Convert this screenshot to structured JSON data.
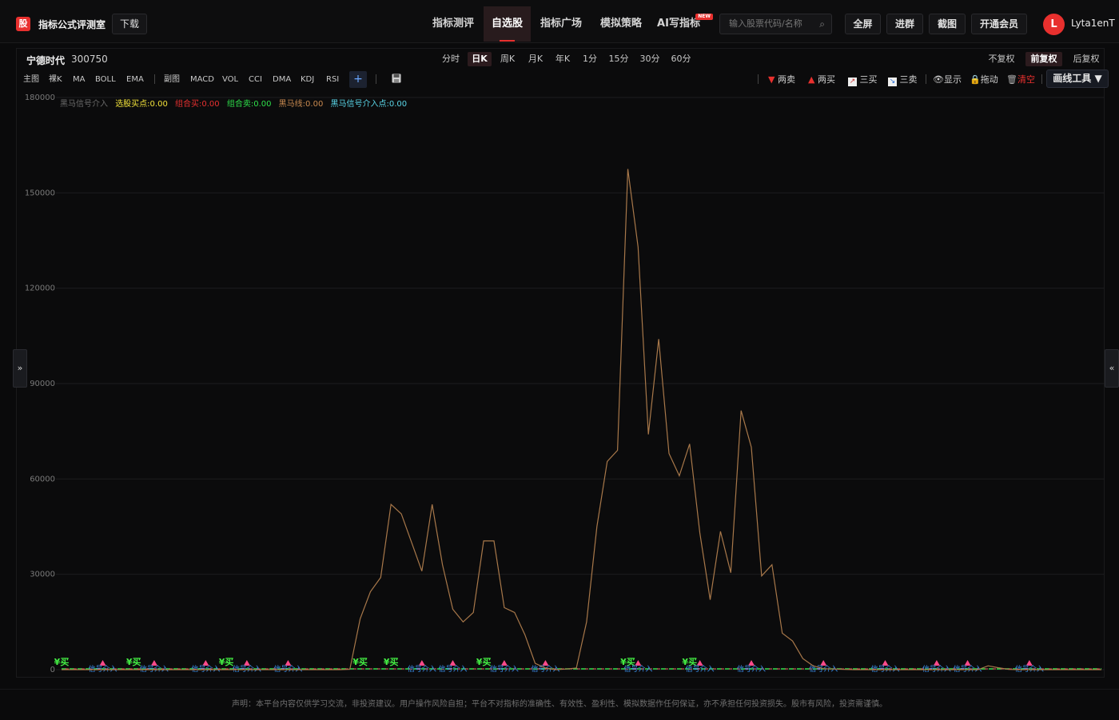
{
  "header": {
    "logo_char": "股",
    "site_title": "指标公式评测室",
    "download_label": "下载",
    "nav": [
      {
        "label": "指标测评",
        "active": false
      },
      {
        "label": "自选股",
        "active": true
      },
      {
        "label": "指标广场",
        "active": false
      },
      {
        "label": "模拟策略",
        "active": false
      },
      {
        "label": "AI写指标",
        "active": false,
        "badge": "NEW"
      }
    ],
    "search_placeholder": "输入股票代码/名称",
    "buttons": [
      "全屏",
      "进群",
      "截图",
      "开通会员"
    ],
    "avatar_letter": "L",
    "username": "Lyta1enT"
  },
  "stock": {
    "name": "宁德时代",
    "code": "300750"
  },
  "periods": [
    {
      "label": "分时",
      "active": false
    },
    {
      "label": "日K",
      "active": true
    },
    {
      "label": "周K",
      "active": false
    },
    {
      "label": "月K",
      "active": false
    },
    {
      "label": "年K",
      "active": false
    },
    {
      "label": "1分",
      "active": false
    },
    {
      "label": "15分",
      "active": false
    },
    {
      "label": "30分",
      "active": false
    },
    {
      "label": "60分",
      "active": false
    }
  ],
  "adjust": [
    {
      "label": "不复权",
      "active": false
    },
    {
      "label": "前复权",
      "active": true
    },
    {
      "label": "后复权",
      "active": false
    }
  ],
  "indicators_main": [
    "主图",
    "裸K",
    "MA",
    "BOLL",
    "EMA"
  ],
  "indicators_sub": [
    "副图",
    "MACD",
    "VOL",
    "CCI",
    "DMA",
    "KDJ",
    "RSI"
  ],
  "plus_label": "+",
  "tools": [
    {
      "icon": "triangle-down-icon",
      "label": "两卖"
    },
    {
      "icon": "triangle-up-icon",
      "label": "两买"
    },
    {
      "icon": "line-up-icon",
      "label": "三买"
    },
    {
      "icon": "line-down-icon",
      "label": "三卖"
    },
    {
      "icon": "eye-icon",
      "label": "显示"
    },
    {
      "icon": "lock-icon",
      "label": "拖动"
    },
    {
      "icon": "trash-icon",
      "label": "清空"
    }
  ],
  "draw_tool_label": "画线工具 ▼",
  "side_left": "»",
  "side_right": "«",
  "legend": [
    {
      "label": "黑马信号介入",
      "color": "#6b6b6b"
    },
    {
      "label": "选股买点:0.00",
      "color": "#f2e23a"
    },
    {
      "label": "组合买:0.00",
      "color": "#e83030"
    },
    {
      "label": "组合卖:0.00",
      "color": "#2ee04a"
    },
    {
      "label": "黑马线:0.00",
      "color": "#c98a50"
    },
    {
      "label": "黑马信号介入点:0.00",
      "color": "#5ad6e8"
    }
  ],
  "footer": "声明：本平台内容仅供学习交流，非投资建议。用户操作风险自担；平台不对指标的准确性、有效性、盈利性、模拟数据作任何保证，亦不承担任何投资损失。股市有风险，投资需谨慎。",
  "chart_data": {
    "type": "line",
    "ylim": [
      0,
      180000
    ],
    "yticks": [
      0,
      30000,
      60000,
      90000,
      120000,
      150000,
      180000
    ],
    "series": [
      {
        "name": "黑马线",
        "color": "#a8784a",
        "values": [
          0,
          0,
          0,
          0,
          0,
          0,
          0,
          0,
          0,
          0,
          0,
          0,
          0,
          0,
          0,
          0,
          0,
          0,
          0,
          0,
          0,
          0,
          0,
          0,
          0,
          0,
          0,
          0,
          100,
          16000,
          24500,
          29000,
          52000,
          49000,
          40000,
          31000,
          52000,
          33000,
          19000,
          15000,
          18000,
          40500,
          40500,
          19500,
          18000,
          11000,
          2000,
          500,
          0,
          200,
          500,
          15000,
          45000,
          65500,
          69000,
          157500,
          133000,
          74000,
          104000,
          68000,
          61000,
          71000,
          43000,
          22000,
          43500,
          30500,
          81500,
          70000,
          29500,
          33000,
          11500,
          9000,
          3500,
          1200,
          300,
          200,
          100,
          0,
          0,
          0,
          0,
          0,
          0,
          0,
          0,
          0,
          0,
          0,
          0,
          0,
          1200,
          600,
          100,
          0,
          0,
          0,
          0,
          0,
          0,
          0,
          0,
          0
        ]
      }
    ],
    "buy_markers": [
      0,
      7,
      16,
      29,
      32,
      41,
      55,
      61
    ],
    "sell_markers": [
      4,
      9,
      14,
      18,
      22,
      35,
      38,
      43,
      47,
      56,
      62,
      67,
      74,
      80,
      85,
      88,
      94
    ],
    "marker_text": "¥买",
    "signal_text": "信号介入"
  }
}
